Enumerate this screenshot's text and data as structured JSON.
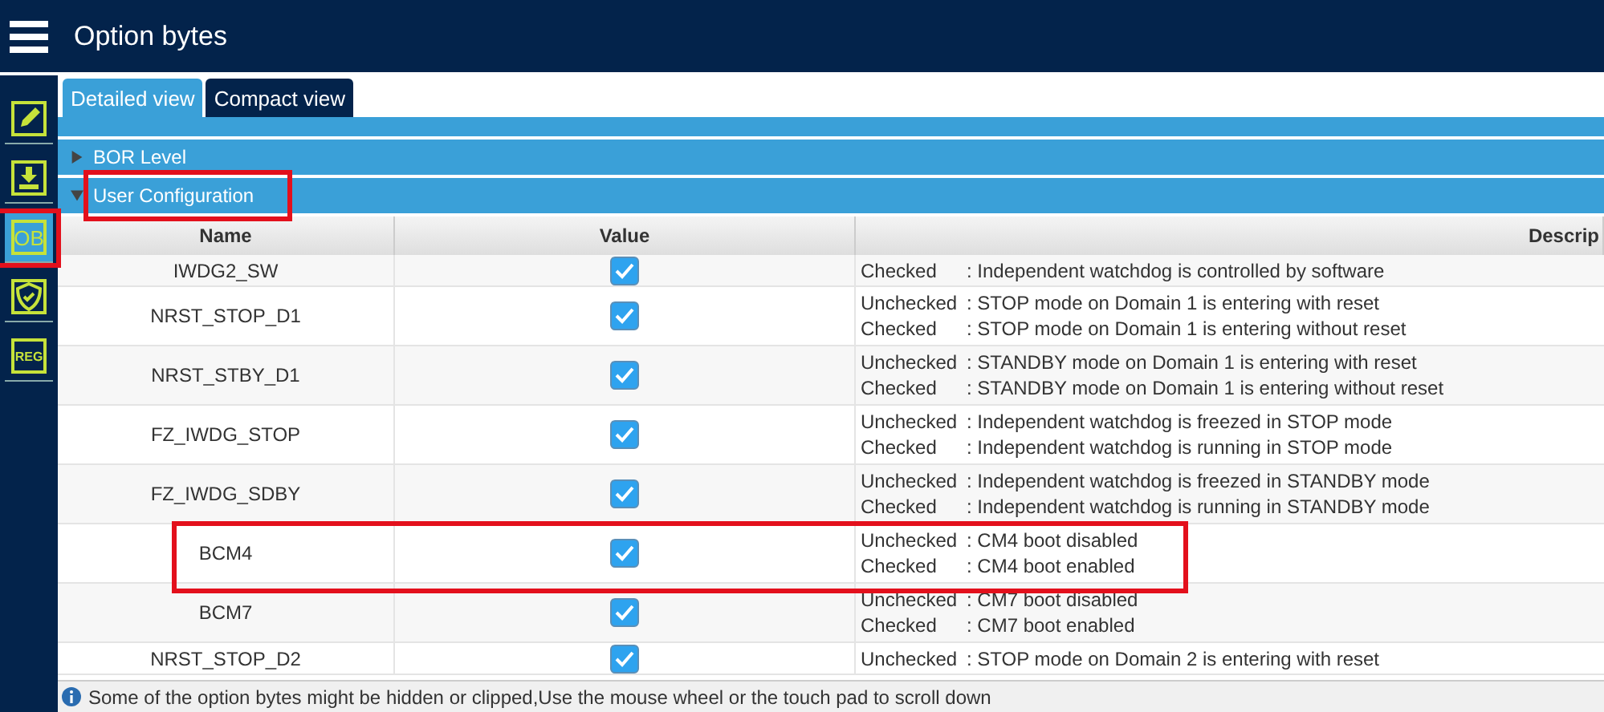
{
  "header": {
    "title": "Option bytes"
  },
  "sidebar": {
    "items": [
      {
        "kind": "pencil",
        "selected": false,
        "highlighted": false
      },
      {
        "kind": "download",
        "selected": false,
        "highlighted": false
      },
      {
        "kind": "text",
        "label": "OB",
        "selected": true,
        "highlighted": true
      },
      {
        "kind": "shield",
        "selected": false,
        "highlighted": false
      },
      {
        "kind": "text",
        "label": "REG",
        "selected": false,
        "highlighted": false
      }
    ]
  },
  "tabs": [
    {
      "label": "Detailed view",
      "selected": true
    },
    {
      "label": "Compact view",
      "selected": false
    }
  ],
  "sections": [
    {
      "kind": "clipped"
    },
    {
      "kind": "group",
      "label": "BOR Level",
      "expanded": false,
      "highlighted": false
    },
    {
      "kind": "group",
      "label": "User Configuration",
      "expanded": true,
      "highlighted": true
    }
  ],
  "table": {
    "columns": [
      "Name",
      "Value",
      "Descrip"
    ],
    "rows": [
      {
        "name": "IWDG2_SW",
        "checked": true,
        "highlighted": false,
        "description": [
          {
            "state": "Checked",
            "text": ": Independent watchdog is controlled by software"
          }
        ]
      },
      {
        "name": "NRST_STOP_D1",
        "checked": true,
        "highlighted": false,
        "description": [
          {
            "state": "Unchecked",
            "text": ": STOP mode on Domain 1 is entering with reset"
          },
          {
            "state": "Checked",
            "text": ": STOP mode on Domain 1 is entering without reset"
          }
        ]
      },
      {
        "name": "NRST_STBY_D1",
        "checked": true,
        "highlighted": false,
        "description": [
          {
            "state": "Unchecked",
            "text": ": STANDBY mode on Domain 1 is entering with reset"
          },
          {
            "state": "Checked",
            "text": ": STANDBY mode on Domain 1 is entering without reset"
          }
        ]
      },
      {
        "name": "FZ_IWDG_STOP",
        "checked": true,
        "highlighted": false,
        "description": [
          {
            "state": "Unchecked",
            "text": ": Independent watchdog is freezed in STOP mode"
          },
          {
            "state": "Checked",
            "text": ": Independent watchdog is running in STOP mode"
          }
        ]
      },
      {
        "name": "FZ_IWDG_SDBY",
        "checked": true,
        "highlighted": false,
        "description": [
          {
            "state": "Unchecked",
            "text": ": Independent watchdog is freezed in STANDBY mode"
          },
          {
            "state": "Checked",
            "text": ": Independent watchdog is running in STANDBY mode"
          }
        ]
      },
      {
        "name": "BCM4",
        "checked": true,
        "highlighted": true,
        "description": [
          {
            "state": "Unchecked",
            "text": ": CM4 boot disabled"
          },
          {
            "state": "Checked",
            "text": ": CM4 boot enabled"
          }
        ]
      },
      {
        "name": "BCM7",
        "checked": true,
        "highlighted": false,
        "description": [
          {
            "state": "Unchecked",
            "text": ": CM7 boot disabled"
          },
          {
            "state": "Checked",
            "text": ": CM7 boot enabled"
          }
        ]
      },
      {
        "name": "NRST_STOP_D2",
        "checked": true,
        "highlighted": false,
        "description": [
          {
            "state": "Unchecked",
            "text": ": STOP mode on Domain 2 is entering with reset"
          }
        ]
      }
    ]
  },
  "status_bar": {
    "text": "Some of the option bytes might be hidden or clipped,Use the mouse wheel or the touch pad to scroll down"
  }
}
